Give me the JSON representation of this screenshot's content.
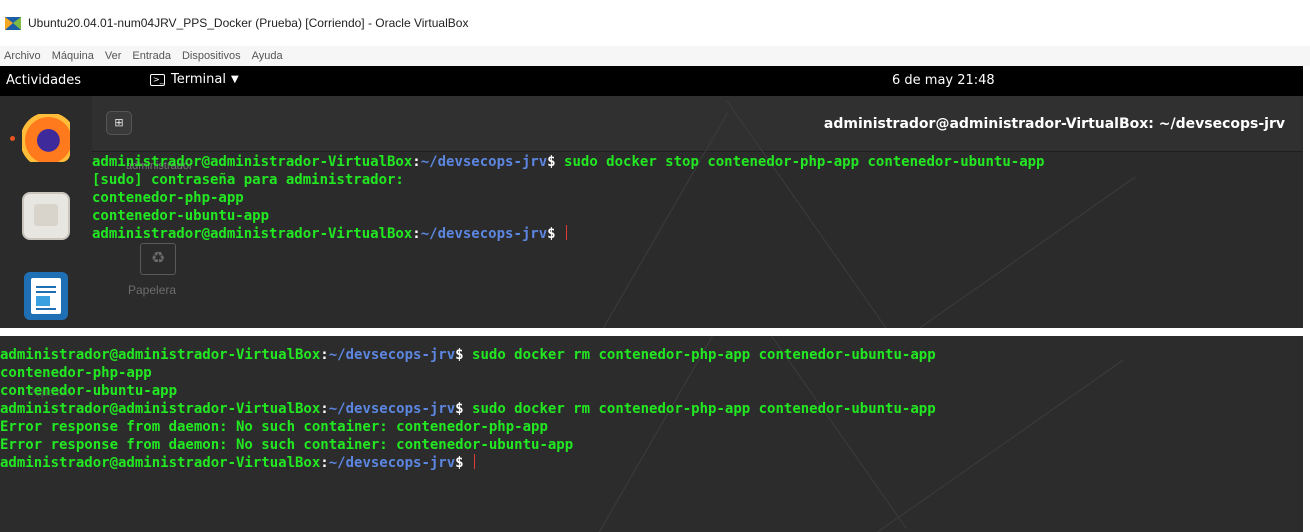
{
  "window": {
    "title": "Ubuntu20.04.01-num04JRV_PPS_Docker (Prueba) [Corriendo] - Oracle VirtualBox",
    "icon": "virtualbox-icon"
  },
  "menubar": {
    "items": [
      "Archivo",
      "Máquina",
      "Ver",
      "Entrada",
      "Dispositivos",
      "Ayuda"
    ]
  },
  "topbar": {
    "activities": "Actividades",
    "app_menu": "Terminal",
    "clock": "6 de may  21:48"
  },
  "dock": {
    "items": [
      "firefox-icon",
      "files-icon",
      "writer-icon"
    ]
  },
  "desktop": {
    "label_top": "administrador",
    "trash_label": "Papelera"
  },
  "terminal1": {
    "title": "administrador@administrador-VirtualBox: ~/devsecops-jrv",
    "new_tab_icon": "new-tab-icon",
    "lines": [
      {
        "type": "prompt",
        "user": "administrador@administrador-VirtualBox",
        "path": "~/devsecops-jrv",
        "cmd": " sudo docker stop contenedor-php-app contenedor-ubuntu-app"
      },
      {
        "type": "out",
        "text": "[sudo] contraseña para administrador:"
      },
      {
        "type": "out",
        "text": "contenedor-php-app"
      },
      {
        "type": "out",
        "text": "contenedor-ubuntu-app"
      },
      {
        "type": "prompt",
        "user": "administrador@administrador-VirtualBox",
        "path": "~/devsecops-jrv",
        "cmd": " "
      }
    ]
  },
  "terminal2": {
    "ghost_label": "Papelera",
    "lines": [
      {
        "type": "prompt",
        "user": "administrador@administrador-VirtualBox",
        "path": "~/devsecops-jrv",
        "cmd": " sudo docker rm contenedor-php-app contenedor-ubuntu-app"
      },
      {
        "type": "out",
        "text": "contenedor-php-app"
      },
      {
        "type": "out",
        "text": "contenedor-ubuntu-app"
      },
      {
        "type": "prompt",
        "user": "administrador@administrador-VirtualBox",
        "path": "~/devsecops-jrv",
        "cmd": " sudo docker rm contenedor-php-app contenedor-ubuntu-app"
      },
      {
        "type": "out",
        "text": "Error response from daemon: No such container: contenedor-php-app"
      },
      {
        "type": "out",
        "text": "Error response from daemon: No such container: contenedor-ubuntu-app"
      },
      {
        "type": "prompt",
        "user": "administrador@administrador-VirtualBox",
        "path": "~/devsecops-jrv",
        "cmd": " "
      }
    ]
  },
  "colors": {
    "prompt_user": "#22e822",
    "prompt_path": "#5c86e0",
    "terminal_bg": "#2c2c2c",
    "cursor": "#e03a3a"
  }
}
